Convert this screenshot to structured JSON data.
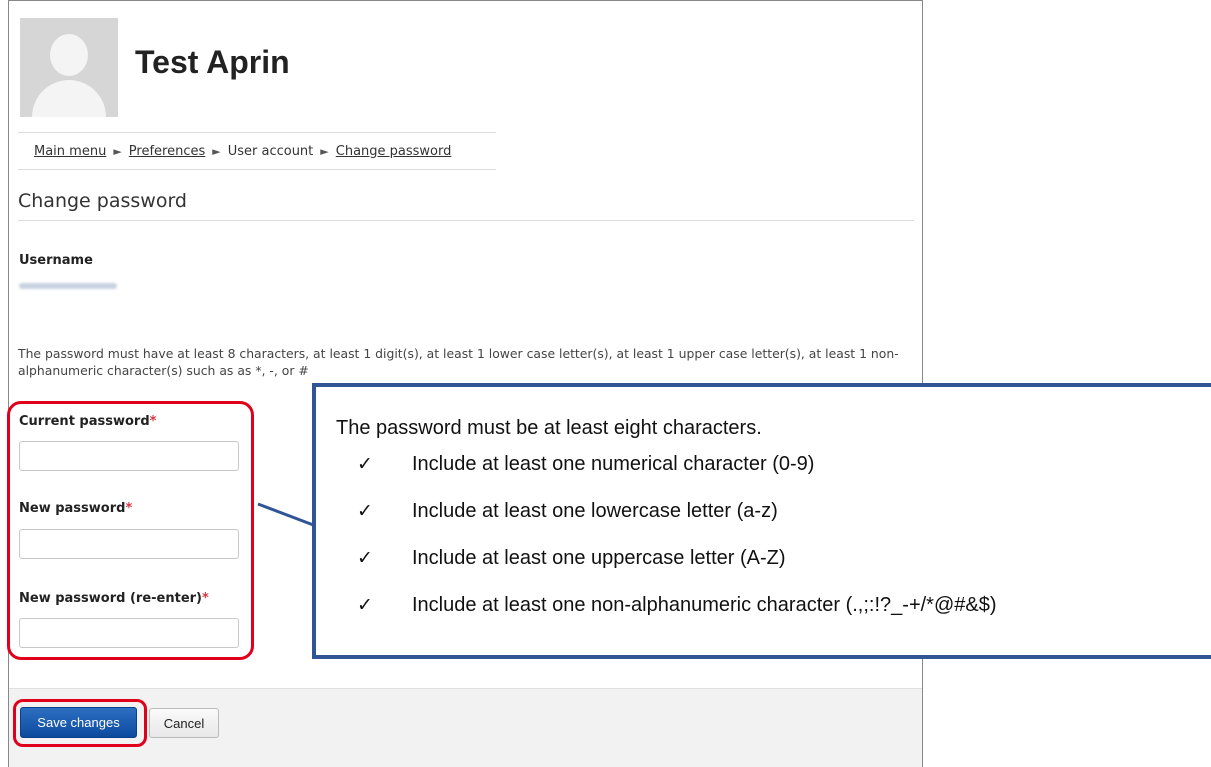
{
  "profile": {
    "name": "Test Aprin"
  },
  "breadcrumb": {
    "items": [
      {
        "label": "Main menu"
      },
      {
        "label": "Preferences"
      },
      {
        "label": "User account"
      },
      {
        "label": "Change password"
      }
    ],
    "separator": "►"
  },
  "page": {
    "heading": "Change password"
  },
  "username": {
    "label": "Username"
  },
  "policy_text": "The password must have at least 8 characters, at least 1 digit(s), at least 1 lower case letter(s), at least 1 upper case letter(s), at least 1 non-alphanumeric character(s) such as as *, -, or #",
  "fields": {
    "required_marker": "*",
    "current": {
      "label": "Current password",
      "value": ""
    },
    "new": {
      "label": "New password",
      "value": ""
    },
    "confirm": {
      "label": "New password (re-enter)",
      "value": ""
    }
  },
  "buttons": {
    "save": "Save changes",
    "cancel": "Cancel"
  },
  "callout": {
    "title": "The password must be at least eight characters.",
    "check_glyph": "✓",
    "items": [
      "Include at least one numerical character (0-9)",
      "Include at least one lowercase letter (a-z)",
      "Include at least one uppercase letter (A-Z)",
      "Include at least one non-alphanumeric character (.,;:!?_-+/*@#&$)"
    ]
  },
  "colors": {
    "highlight": "#e0001b",
    "callout_border": "#2f5597",
    "primary_button": "#0c4a9e",
    "required": "#d9363e"
  }
}
